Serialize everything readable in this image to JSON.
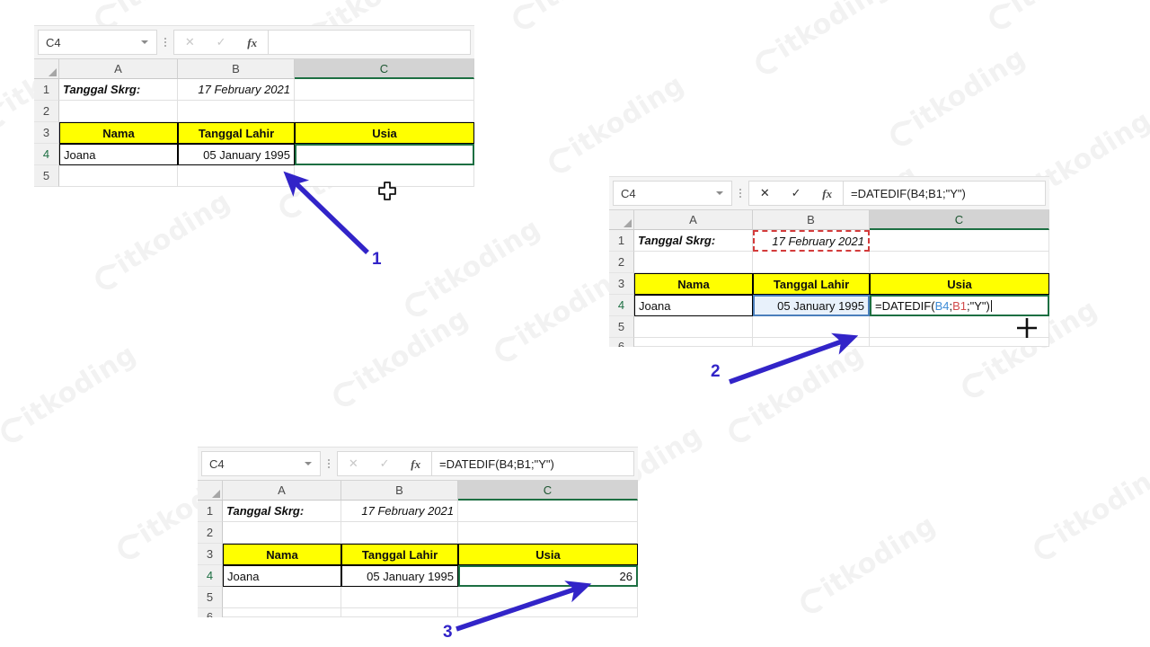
{
  "app": "Microsoft Excel",
  "brand": {
    "accent_green": "#1d6f42",
    "highlight_yellow": "#ffff00",
    "arrow_blue": "#3224c8",
    "ref_red": "#d14b4b",
    "ref_blue": "#3d8bd6"
  },
  "watermark": {
    "text": "itkoding",
    "logo": "leaf-logo-icon"
  },
  "panels": [
    {
      "id": "panel-step-1",
      "namebox": {
        "value": "C4"
      },
      "formula_bar": {
        "cancel_label": "✕",
        "confirm_label": "✓",
        "fx_label": "fx",
        "icons_active": false,
        "value": ""
      },
      "columns": [
        "A",
        "B",
        "C"
      ],
      "selected_column": "C",
      "rows": [
        "1",
        "2",
        "3",
        "4",
        "5"
      ],
      "selected_row": "4",
      "cells": {
        "A1": "Tanggal Skrg:",
        "B1": "17 February 2021",
        "C1": "",
        "A2": "",
        "B2": "",
        "C2": "",
        "A3": "Nama",
        "B3": "Tanggal Lahir",
        "C3": "Usia",
        "A4": "Joana",
        "B4": "05 January 1995",
        "C4": "",
        "A5": "",
        "B5": "",
        "C5": ""
      },
      "active_cell": "C4",
      "cursor": "white-plus-cell-cursor"
    },
    {
      "id": "panel-step-2",
      "namebox": {
        "value": "C4"
      },
      "formula_bar": {
        "cancel_label": "✕",
        "confirm_label": "✓",
        "fx_label": "fx",
        "icons_active": true,
        "value": "=DATEDIF(B4;B1;\"Y\")"
      },
      "columns": [
        "A",
        "B",
        "C"
      ],
      "selected_column": "C",
      "rows": [
        "1",
        "2",
        "3",
        "4",
        "5",
        "6"
      ],
      "selected_row": "4",
      "cells": {
        "A1": "Tanggal Skrg:",
        "B1": "17 February 2021",
        "C1": "",
        "A2": "",
        "B2": "",
        "C2": "",
        "A3": "Nama",
        "B3": "Tanggal Lahir",
        "C3": "Usia",
        "A4": "Joana",
        "B4": "05 January 1995",
        "C4_formula_parts": {
          "p1": "=DATEDIF(",
          "ref1": "B4",
          "sep": ";",
          "ref2": "B1",
          "p2": ";\"Y\")"
        },
        "A5": "",
        "B5": "",
        "C5": ""
      },
      "active_cell": "C4",
      "reference_highlight_red": "B1",
      "reference_highlight_blue": "B4",
      "cursor": "black-crosshair-fill-handle"
    },
    {
      "id": "panel-step-3",
      "namebox": {
        "value": "C4"
      },
      "formula_bar": {
        "cancel_label": "✕",
        "confirm_label": "✓",
        "fx_label": "fx",
        "icons_active": false,
        "value": "=DATEDIF(B4;B1;\"Y\")"
      },
      "columns": [
        "A",
        "B",
        "C"
      ],
      "selected_column": "C",
      "rows": [
        "1",
        "2",
        "3",
        "4",
        "5",
        "6"
      ],
      "selected_row": "4",
      "cells": {
        "A1": "Tanggal Skrg:",
        "B1": "17 February 2021",
        "C1": "",
        "A2": "",
        "B2": "",
        "C2": "",
        "A3": "Nama",
        "B3": "Tanggal Lahir",
        "C3": "Usia",
        "A4": "Joana",
        "B4": "05 January 1995",
        "C4": "26",
        "A5": "",
        "B5": "",
        "C5": ""
      },
      "active_cell": "C4"
    }
  ],
  "annotations": [
    {
      "id": "callout-1",
      "label": "1"
    },
    {
      "id": "callout-2",
      "label": "2"
    },
    {
      "id": "callout-3",
      "label": "3"
    }
  ]
}
